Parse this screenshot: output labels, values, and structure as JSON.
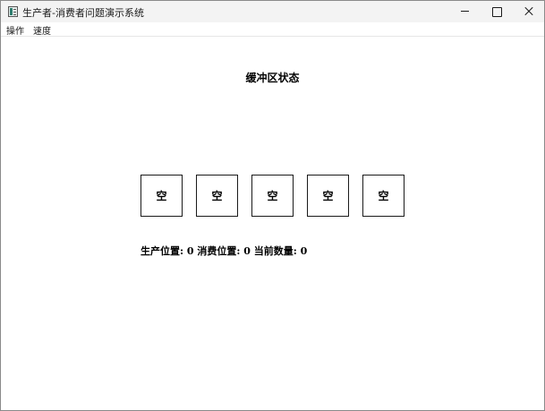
{
  "window": {
    "title": "生产者-消费者问题演示系统",
    "icon": "app-window-icon"
  },
  "menu": {
    "items": [
      {
        "label": "操作"
      },
      {
        "label": "速度"
      }
    ]
  },
  "main": {
    "heading": "缓冲区状态",
    "buffer": [
      {
        "label": "空"
      },
      {
        "label": "空"
      },
      {
        "label": "空"
      },
      {
        "label": "空"
      },
      {
        "label": "空"
      }
    ],
    "status": "生产位置: 0  消费位置: 0  当前数量: 0"
  }
}
